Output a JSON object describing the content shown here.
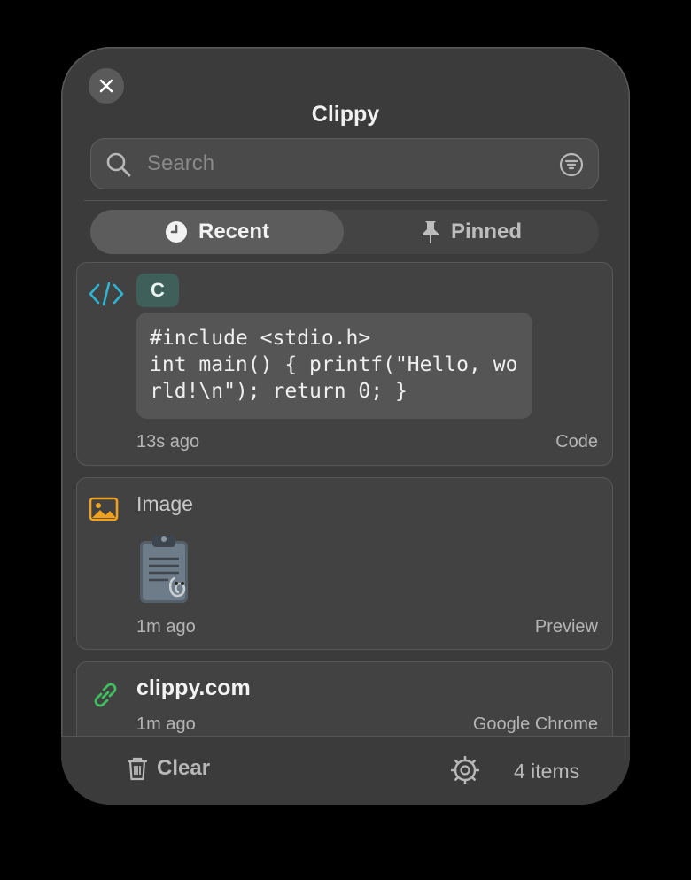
{
  "app": {
    "title": "Clippy"
  },
  "search": {
    "placeholder": "Search",
    "value": ""
  },
  "tabs": [
    {
      "label": "Recent",
      "selected": true,
      "icon": "clock-icon"
    },
    {
      "label": "Pinned",
      "selected": false,
      "icon": "pin-icon"
    }
  ],
  "items": [
    {
      "kind": "code",
      "icon": "code-icon",
      "badge": "C",
      "content": "#include <stdio.h>\nint main() { printf(\"Hello, world!\\n\"); return 0; }",
      "time": "13s ago",
      "source": "Code"
    },
    {
      "kind": "image",
      "icon": "image-icon",
      "label": "Image",
      "time": "1m ago",
      "source": "Preview"
    },
    {
      "kind": "link",
      "icon": "link-icon",
      "title": "clippy.com",
      "time": "1m ago",
      "source": "Google Chrome"
    }
  ],
  "footer": {
    "clear_label": "Clear",
    "count_label": "4 items"
  },
  "colors": {
    "code_icon": "#2fb4cf",
    "image_icon": "#f0a21e",
    "link_icon": "#3fbf5e",
    "badge_bg": "#3f5f5b",
    "window_bg": "#3b3b3b"
  }
}
